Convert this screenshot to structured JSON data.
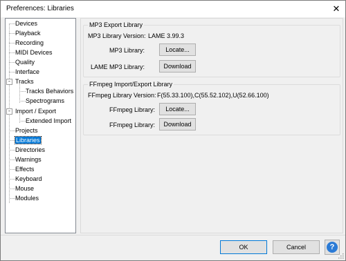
{
  "window": {
    "title": "Preferences: Libraries",
    "close_glyph": "✕"
  },
  "sidebar": {
    "items": [
      {
        "label": "Devices"
      },
      {
        "label": "Playback"
      },
      {
        "label": "Recording"
      },
      {
        "label": "MIDI Devices"
      },
      {
        "label": "Quality"
      },
      {
        "label": "Interface"
      },
      {
        "label": "Tracks"
      },
      {
        "label": "Tracks Behaviors"
      },
      {
        "label": "Spectrograms"
      },
      {
        "label": "Import / Export"
      },
      {
        "label": "Extended Import"
      },
      {
        "label": "Projects"
      },
      {
        "label": "Libraries"
      },
      {
        "label": "Directories"
      },
      {
        "label": "Warnings"
      },
      {
        "label": "Effects"
      },
      {
        "label": "Keyboard"
      },
      {
        "label": "Mouse"
      },
      {
        "label": "Modules"
      }
    ],
    "selected": "Libraries",
    "expander_glyph": "-"
  },
  "mp3": {
    "group_title": "MP3 Export Library",
    "version_label": "MP3 Library Version:",
    "version_value": "LAME 3.99.3",
    "library_label": "MP3 Library:",
    "locate_button": "Locate...",
    "lame_label": "LAME MP3 Library:",
    "download_button": "Download"
  },
  "ffmpeg": {
    "group_title": "FFmpeg Import/Export Library",
    "version_label": "FFmpeg Library Version:",
    "version_value": "F(55.33.100),C(55.52.102),U(52.66.100)",
    "library_label": "FFmpeg Library:",
    "locate_button": "Locate...",
    "download_label": "FFmpeg Library:",
    "download_button": "Download"
  },
  "footer": {
    "ok_button": "OK",
    "cancel_button": "Cancel",
    "help_glyph": "?"
  },
  "colors": {
    "selection": "#0078d7",
    "help_icon": "#2b7bd6"
  },
  "icons": [
    "close-icon",
    "help-icon",
    "expander-collapse-icon",
    "resize-grip-icon"
  ]
}
